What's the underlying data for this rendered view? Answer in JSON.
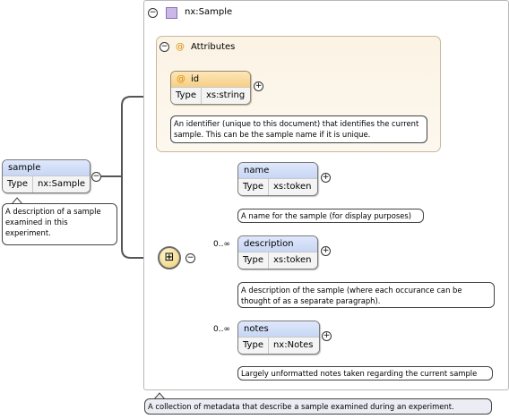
{
  "root": {
    "name": "sample",
    "type_label": "Type",
    "type_value": "nx:Sample",
    "doc": "A description of a sample examined in this experiment."
  },
  "complex_type": {
    "name": "nx:Sample",
    "doc": "A collection of metadata that describe a sample examined during an experiment."
  },
  "attributes_group": {
    "label": "Attributes",
    "at_symbol": "@",
    "items": [
      {
        "name": "id",
        "type_label": "Type",
        "type_value": "xs:string",
        "doc": "An identifier (unique to this document) that identifies the current sample. This can be the sample name if it is unique."
      }
    ]
  },
  "sequence": {
    "icon": "sequence-icon",
    "children": [
      {
        "name": "name",
        "occurrence": "",
        "type_label": "Type",
        "type_value": "xs:token",
        "doc": "A name for the sample (for display purposes)"
      },
      {
        "name": "description",
        "occurrence": "0..∞",
        "type_label": "Type",
        "type_value": "xs:token",
        "doc": "A description of the sample (where each occurance can be thought of as a separate paragraph)."
      },
      {
        "name": "notes",
        "occurrence": "0..∞",
        "type_label": "Type",
        "type_value": "nx:Notes",
        "doc": "Largely unformatted notes taken regarding the current sample"
      }
    ]
  },
  "symbols": {
    "collapse": "−",
    "expand": "+"
  },
  "colors": {
    "element_header": "#c7d6f4",
    "attribute_header": "#f6cf86",
    "attributes_bg": "#fbf3e4",
    "type_icon": "#c9b8e8"
  }
}
